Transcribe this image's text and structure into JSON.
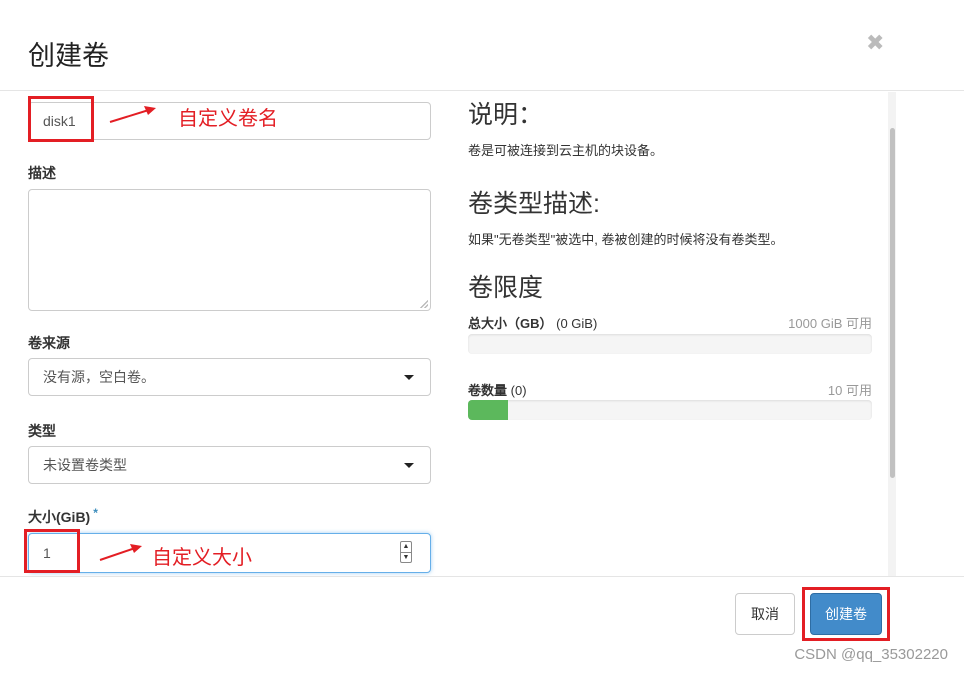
{
  "dialog": {
    "title": "创建卷",
    "close_icon": "close-icon"
  },
  "form": {
    "name_value": "disk1",
    "description_label": "描述",
    "description_value": "",
    "source_label": "卷来源",
    "source_value": "没有源，空白卷。",
    "type_label": "类型",
    "type_value": "未设置卷类型",
    "size_label": "大小(GiB)",
    "size_required": "*",
    "size_value": "1"
  },
  "annotations": {
    "name_note": "自定义卷名",
    "size_note": "自定义大小",
    "color": "#e31e24"
  },
  "info": {
    "desc_heading": "说明：",
    "desc_text": "卷是可被连接到云主机的块设备。",
    "type_heading": "卷类型描述:",
    "type_text": "如果\"无卷类型\"被选中, 卷被创建的时候将没有卷类型。",
    "limits_heading": "卷限度",
    "total_size_label": "总大小（GB）",
    "total_size_used": "(0 GiB)",
    "total_size_avail": "1000 GiB 可用",
    "total_size_fraction": 0,
    "volume_count_label": "卷数量",
    "volume_count_used": "(0)",
    "volume_count_avail": "10 可用",
    "volume_count_fraction": 0.1,
    "bar_color": "#5cb85c"
  },
  "footer": {
    "cancel_label": "取消",
    "create_label": "创建卷",
    "primary_color": "#428bca"
  },
  "watermark": "CSDN @qq_35302220"
}
